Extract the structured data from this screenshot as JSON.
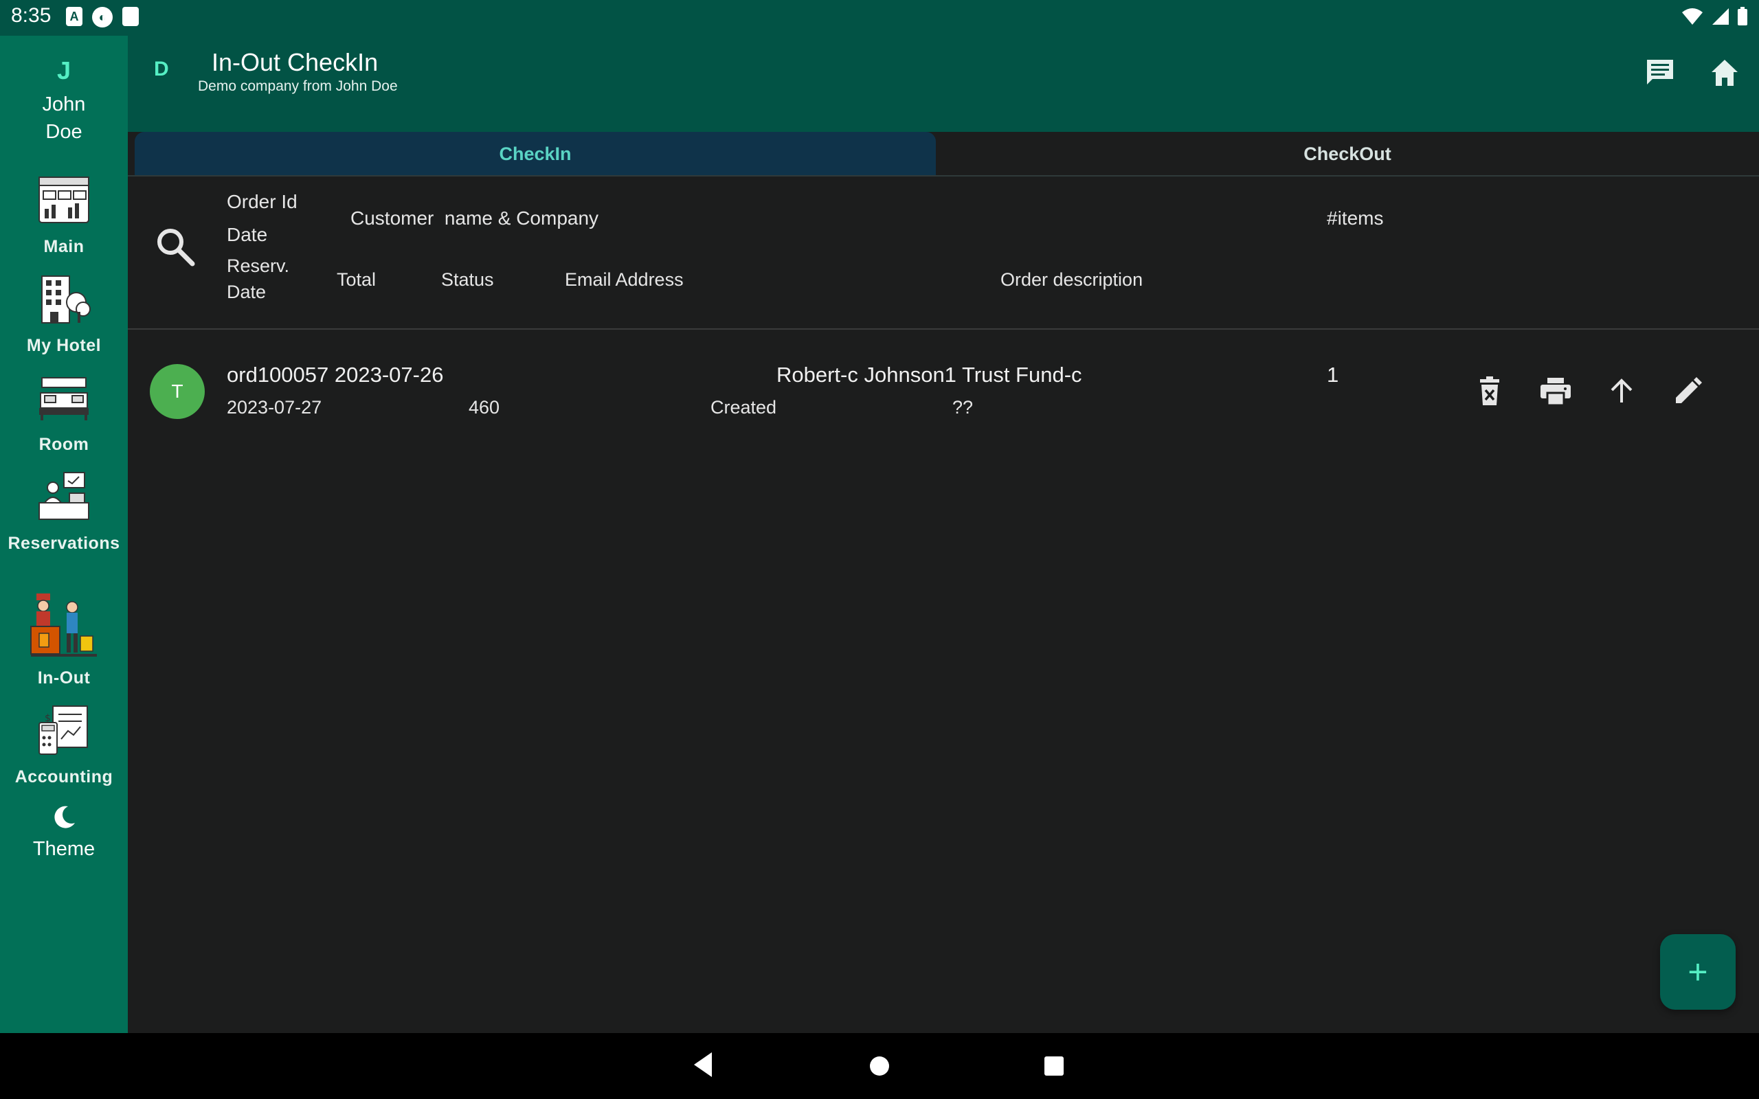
{
  "status_bar": {
    "time": "8:35"
  },
  "user": {
    "initial": "J",
    "name_line1": "John",
    "name_line2": "Doe"
  },
  "rail": {
    "items": [
      {
        "label": "Main",
        "icon": "dashboard-icon"
      },
      {
        "label": "My Hotel",
        "icon": "hotel-building-icon"
      },
      {
        "label": "Room",
        "icon": "hotel-room-bed-icon"
      },
      {
        "label": "Reservations",
        "icon": "reception-desk-icon"
      },
      {
        "label": "In-Out",
        "icon": "checkin-porter-icon"
      },
      {
        "label": "Accounting",
        "icon": "accounting-calculator-icon"
      }
    ],
    "theme_label": "Theme"
  },
  "appbar": {
    "company_initial": "D",
    "title": "In-Out CheckIn",
    "subtitle": "Demo company from John Doe"
  },
  "tabs": [
    {
      "label": "CheckIn",
      "active": true
    },
    {
      "label": "CheckOut",
      "active": false
    }
  ],
  "header": {
    "order_id": "Order Id",
    "date": "Date",
    "customer": "Customer  name & Company",
    "items": "#items",
    "reserv": "Reserv.",
    "reserv_date": "Date",
    "total": "Total",
    "status": "Status",
    "email": "Email Address",
    "description": "Order description"
  },
  "rows": [
    {
      "avatar": "T",
      "order_date": "ord100057 2023-07-26",
      "customer": "Robert-c Johnson1 Trust Fund-c",
      "items": "1",
      "reserv_date": "2023-07-27",
      "total": "460",
      "status": "Created",
      "email": "??",
      "description": ""
    }
  ],
  "fab_label": "+",
  "colors": {
    "appbar": "#025345",
    "rail": "#027057",
    "background": "#1c1d1d",
    "active_tab": "#0f334a",
    "accent": "#55efc4",
    "avatar": "#4caf50"
  }
}
